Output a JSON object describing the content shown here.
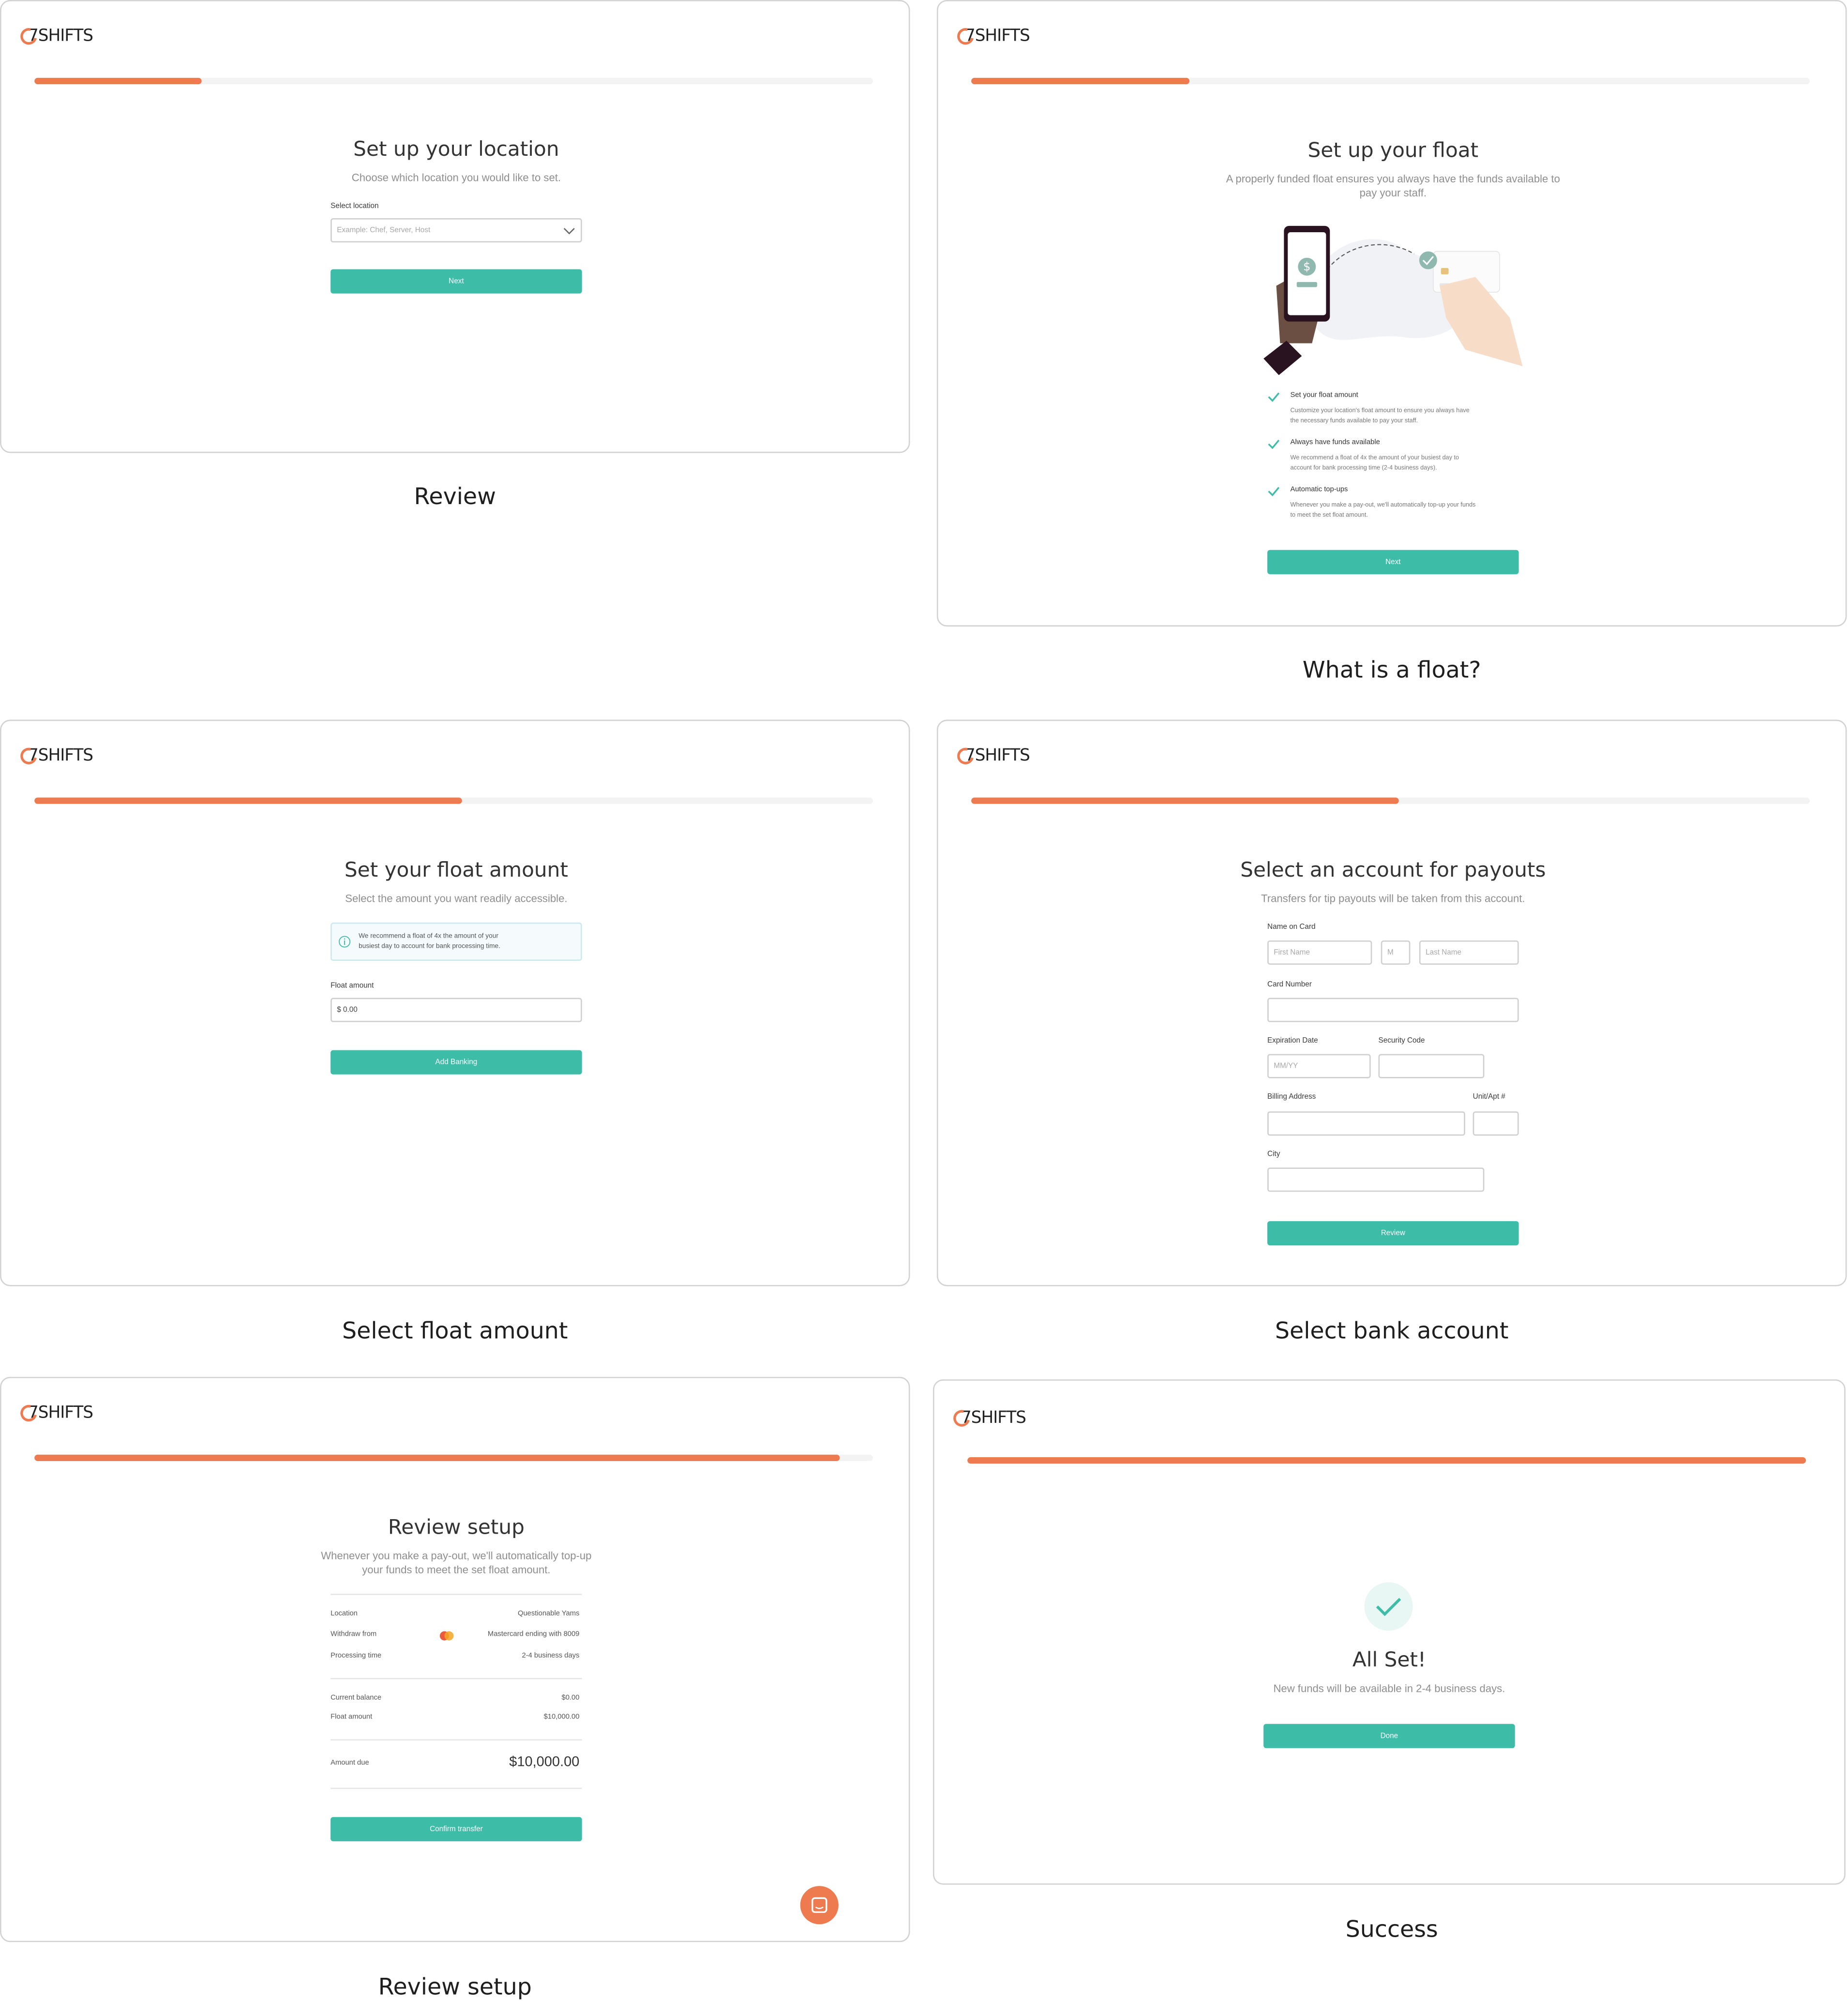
{
  "brand": {
    "logo_text": "7SHIFTS",
    "accent": "#ee7a50",
    "button_color": "#3dbda8"
  },
  "screens": {
    "location": {
      "caption": "Review",
      "title": "Set up your location",
      "subtitle": "Choose which location you would like to set.",
      "select_label": "Select location",
      "select_placeholder": "Example: Chef, Server, Host",
      "next_label": "Next",
      "progress": 0.2
    },
    "float": {
      "caption": "What is a float?",
      "title": "Set up your float",
      "subtitle_line1": "A properly funded float ensures you always have the funds available to",
      "subtitle_line2": "pay your staff.",
      "features": [
        {
          "title": "Set your float amount",
          "line1": "Customize your location's float amount to ensure you always have",
          "line2": "the necessary funds available to pay your staff."
        },
        {
          "title": "Always have funds available",
          "line1": "We recommend a float of 4x the amount of your busiest day to",
          "line2": "account for bank processing time (2-4 business days)."
        },
        {
          "title": "Automatic top-ups",
          "line1": "Whenever you make a pay-out, we'll automatically top-up your funds",
          "line2": "to meet the set float amount."
        }
      ],
      "next_label": "Next",
      "progress": 0.26
    },
    "amount": {
      "caption": "Select float amount",
      "title": "Set your float amount",
      "subtitle": "Select the amount you want readily accessible.",
      "info_line1": "We recommend a float of 4x the amount of your",
      "info_line2": "busiest day to account for bank processing time.",
      "field_label": "Float amount",
      "field_value": "$ 0.00",
      "button_label": "Add Banking",
      "progress": 0.51
    },
    "bank": {
      "caption": "Select bank account",
      "title": "Select an account for payouts",
      "subtitle": "Transfers for tip payouts will be taken from this account.",
      "name_label": "Name on Card",
      "first_placeholder": "First Name",
      "middle_placeholder": "M",
      "last_placeholder": "Last Name",
      "card_label": "Card Number",
      "exp_label": "Expiration Date",
      "exp_placeholder": "MM/YY",
      "sec_label": "Security Code",
      "billing_label": "Billing Address",
      "unit_label": "Unit/Apt #",
      "city_label": "City",
      "button_label": "Review",
      "progress": 0.51
    },
    "review": {
      "caption": "Review setup",
      "title": "Review setup",
      "subtitle_line1": "Whenever you make a pay-out, we'll automatically top-up",
      "subtitle_line2": "your funds to meet the set float amount.",
      "rows": [
        {
          "label": "Location",
          "value": "Questionable Yams"
        },
        {
          "label": "Withdraw from",
          "value": "Mastercard ending with 8009"
        },
        {
          "label": "Processing time",
          "value": "2-4 business days"
        },
        {
          "label": "Current balance",
          "value": "$0.00"
        },
        {
          "label": "Float amount",
          "value": "$10,000.00"
        }
      ],
      "due_label": "Amount due",
      "due_value": "$10,000.00",
      "button_label": "Confirm transfer",
      "progress": 0.96
    },
    "success": {
      "caption": "Success",
      "title": "All Set!",
      "subtitle": "New funds will be available in 2-4 business days.",
      "button_label": "Done",
      "progress": 1.0
    }
  }
}
